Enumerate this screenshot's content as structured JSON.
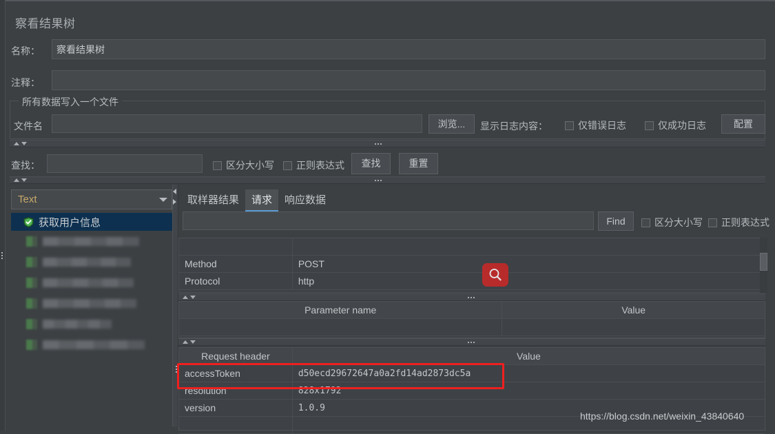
{
  "window": {
    "title": "察看结果树"
  },
  "form": {
    "name_label": "名称：",
    "name_value": "察看结果树",
    "comment_label": "注释：",
    "comment_value": ""
  },
  "file_group": {
    "legend": "所有数据写入一个文件",
    "filename_label": "文件名",
    "filename_value": "",
    "browse_button": "浏览...",
    "log_display_label": "显示日志内容：",
    "errors_only_checkbox": "仅错误日志",
    "success_only_checkbox": "仅成功日志",
    "configure_button": "配置"
  },
  "search_bar": {
    "label": "查找：",
    "value": "",
    "match_case_checkbox": "区分大小写",
    "regex_checkbox": "正则表达式",
    "find_button": "查找",
    "reset_button": "重置"
  },
  "tree": {
    "renderer_selected": "Text",
    "selected_item": "获取用户信息",
    "selected_item_icon": "green-shield-check-icon",
    "blurred_item_widths": [
      140,
      128,
      132,
      136,
      100,
      148
    ]
  },
  "tabs": [
    {
      "label": "取样器结果",
      "active": false
    },
    {
      "label": "请求",
      "active": true
    },
    {
      "label": "响应数据",
      "active": false
    }
  ],
  "find_bar": {
    "value": "",
    "find_button": "Find",
    "match_case_checkbox": "区分大小写",
    "regex_checkbox": "正则表达式"
  },
  "request_table": {
    "headers": [
      "",
      ""
    ],
    "rows": [
      {
        "key": "",
        "value": ""
      },
      {
        "key": "Method",
        "value": "POST"
      },
      {
        "key": "Protocol",
        "value": "http"
      }
    ]
  },
  "parameter_table": {
    "headers": [
      "Parameter name",
      "Value"
    ],
    "rows": [
      {
        "key": "",
        "value": ""
      }
    ]
  },
  "header_table": {
    "headers": [
      "Request header",
      "Value"
    ],
    "rows": [
      {
        "key": "accessToken",
        "value": "d50ecd29672647a0a2fd14ad2873dc5a",
        "highlighted": true
      },
      {
        "key": "resolution",
        "value": "828x1792",
        "highlighted": false
      },
      {
        "key": "version",
        "value": "1.0.9",
        "highlighted": false
      },
      {
        "key": "",
        "value": "",
        "highlighted": false
      }
    ]
  },
  "search_overlay_button": {
    "icon": "magnifier-icon",
    "color": "#b82b2b"
  },
  "watermark": {
    "text": "https://blog.csdn.net/weixin_43840640"
  },
  "colors": {
    "background": "#3c4043",
    "accent": "#5b9bd5",
    "highlight_red": "#f01f1f",
    "selection_blue": "#0d3050",
    "shield_green": "#3f9e42"
  }
}
